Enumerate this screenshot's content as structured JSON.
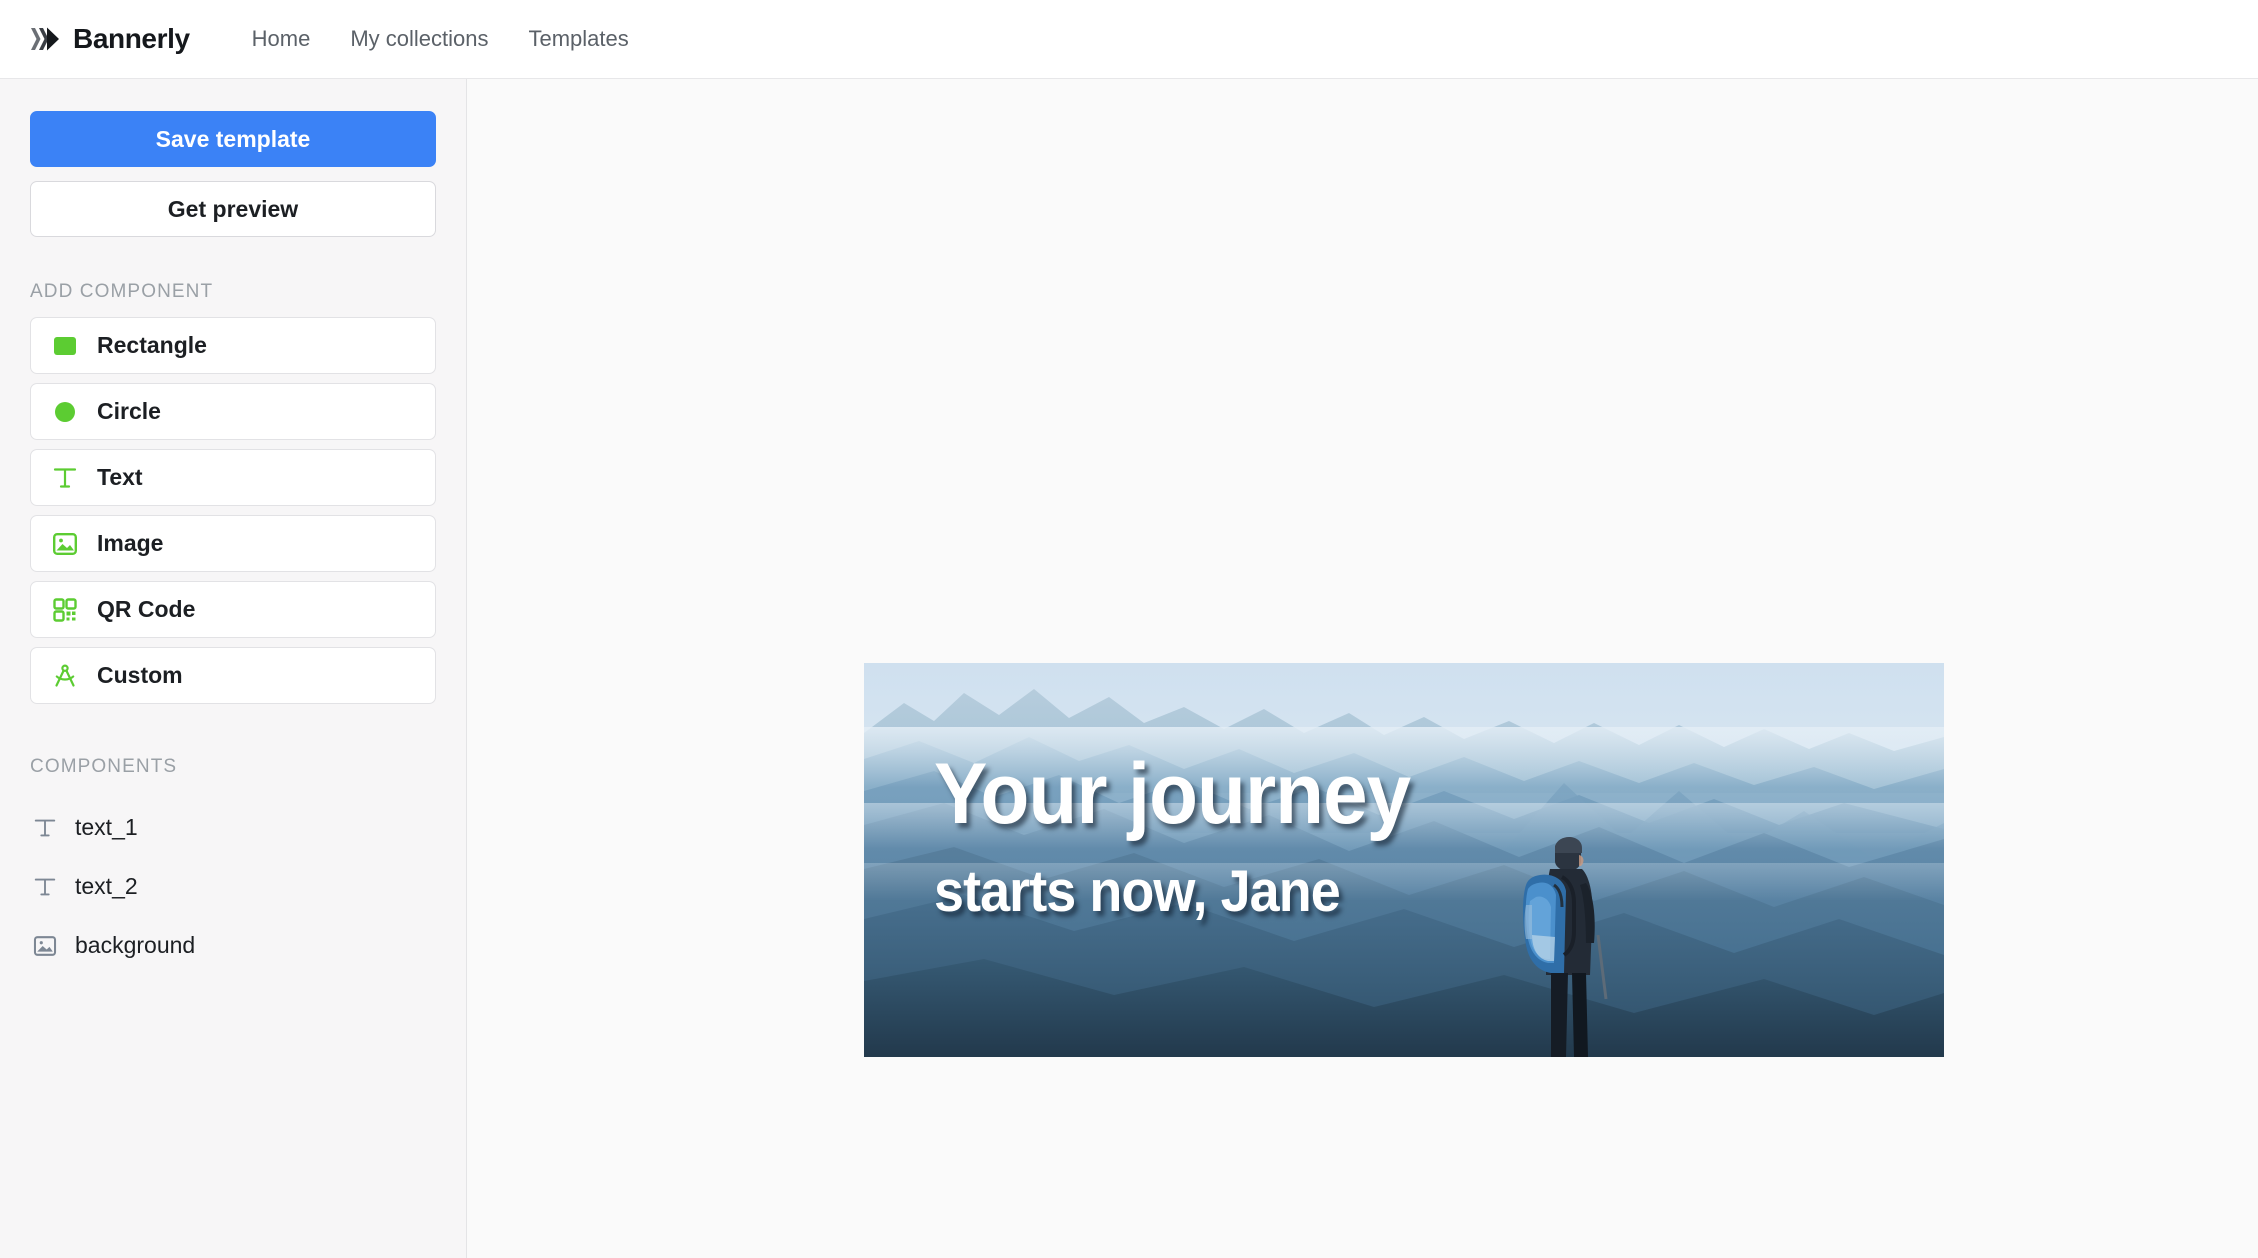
{
  "header": {
    "brand_name": "Bannerly",
    "logo_icon": "chevrons-logo-icon",
    "nav": [
      {
        "label": "Home",
        "name": "nav-home"
      },
      {
        "label": "My collections",
        "name": "nav-my-collections"
      },
      {
        "label": "Templates",
        "name": "nav-templates"
      }
    ]
  },
  "sidebar": {
    "save_label": "Save template",
    "preview_label": "Get preview",
    "add_component_label": "ADD COMPONENT",
    "components_label": "COMPONENTS",
    "sort_up_icon": "arrow-up-icon",
    "sort_down_icon": "arrow-down-icon",
    "add_components": [
      {
        "label": "Rectangle",
        "icon": "rectangle-icon"
      },
      {
        "label": "Circle",
        "icon": "circle-icon"
      },
      {
        "label": "Text",
        "icon": "text-t-icon"
      },
      {
        "label": "Image",
        "icon": "image-icon"
      },
      {
        "label": "QR Code",
        "icon": "qr-code-icon"
      },
      {
        "label": "Custom",
        "icon": "compass-icon"
      }
    ],
    "layers": [
      {
        "label": "text_1",
        "icon": "text-t-icon"
      },
      {
        "label": "text_2",
        "icon": "text-t-icon"
      },
      {
        "label": "background",
        "icon": "image-icon"
      }
    ]
  },
  "canvas": {
    "banner": {
      "headline": "Your journey",
      "subheadline": "starts now, Jane",
      "background_description": "hazy blue mountain ranges with a hiker wearing a blue backpack"
    }
  },
  "colors": {
    "primary_blue": "#3b82f6",
    "icon_green": "#5ccc32",
    "layer_icon_gray": "#7d8794",
    "muted_text": "#9aa0a6",
    "nav_text": "#5b6168",
    "sidebar_bg": "#f7f6f7",
    "canvas_bg": "#fafafa"
  }
}
